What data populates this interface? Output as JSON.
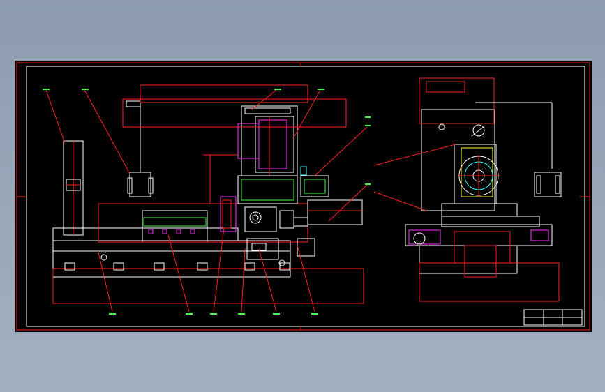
{
  "drawing": {
    "header_label": "",
    "view_label": "",
    "title_block": {
      "part_name": "",
      "scale": ""
    },
    "colors": {
      "background": "#000000",
      "border": "#ff2020",
      "geometry": "#ffffff",
      "leader": "#ff2020",
      "dimension": "#44ff44",
      "accent_magenta": "#ff33ff",
      "accent_cyan": "#33ffff",
      "accent_yellow": "#ffff33"
    }
  }
}
